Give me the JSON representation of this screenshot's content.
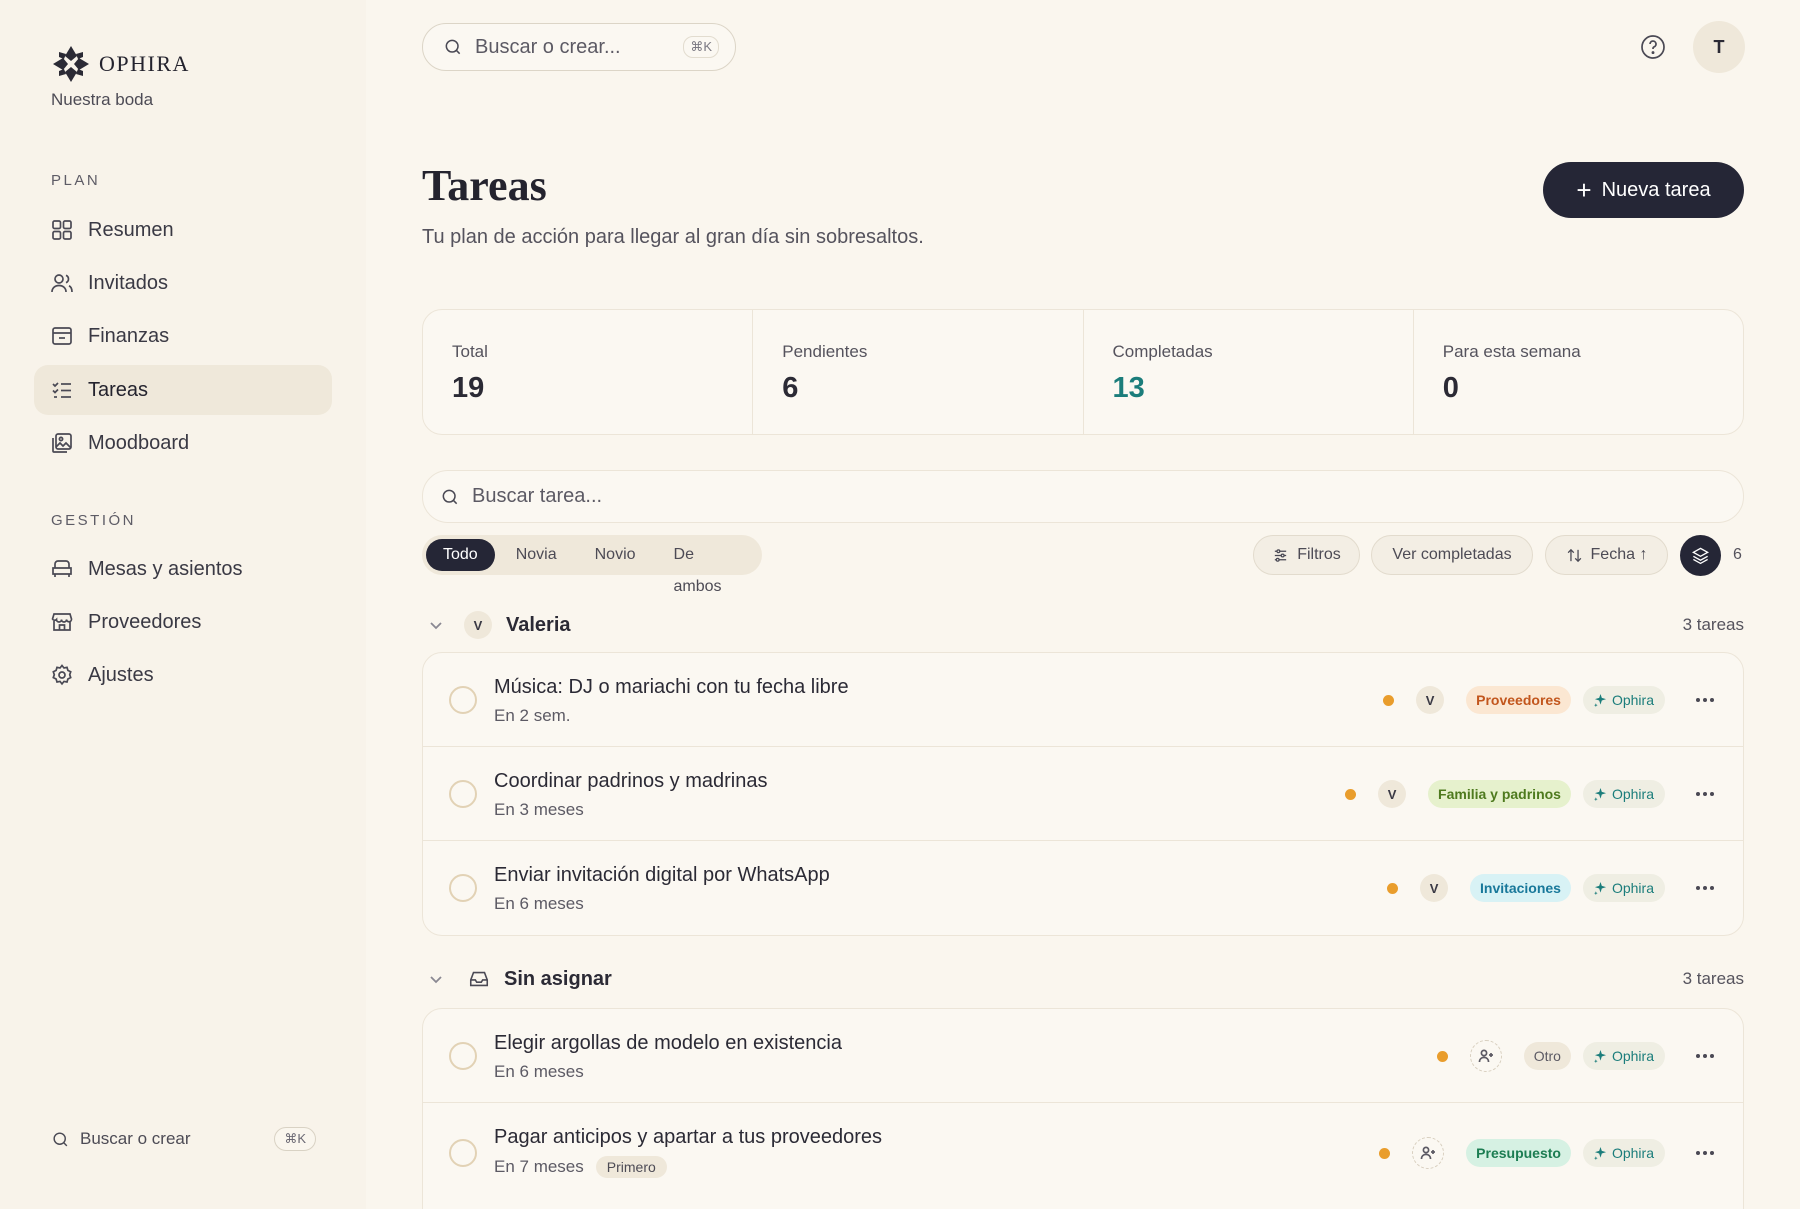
{
  "brand": {
    "name": "OPHIRA",
    "subtitle": "Nuestra boda"
  },
  "sidebar": {
    "plan_label": "PLAN",
    "plan_items": [
      {
        "label": "Resumen",
        "icon": "grid-icon"
      },
      {
        "label": "Invitados",
        "icon": "users-icon"
      },
      {
        "label": "Finanzas",
        "icon": "wallet-icon"
      },
      {
        "label": "Tareas",
        "icon": "checklist-icon",
        "active": true
      },
      {
        "label": "Moodboard",
        "icon": "image-board-icon"
      }
    ],
    "gestion_label": "GESTIÓN",
    "gestion_items": [
      {
        "label": "Mesas y asientos",
        "icon": "seat-icon"
      },
      {
        "label": "Proveedores",
        "icon": "store-icon"
      },
      {
        "label": "Ajustes",
        "icon": "gear-icon"
      }
    ],
    "search_label": "Buscar o crear",
    "search_shortcut": "⌘K"
  },
  "topbar": {
    "search_placeholder": "Buscar o crear...",
    "search_shortcut": "⌘K",
    "avatar_initial": "T"
  },
  "header": {
    "title": "Tareas",
    "subtitle": "Tu plan de acción para llegar al gran día sin sobresaltos.",
    "new_button": "Nueva tarea"
  },
  "stats": [
    {
      "label": "Total",
      "value": "19"
    },
    {
      "label": "Pendientes",
      "value": "6"
    },
    {
      "label": "Completadas",
      "value": "13"
    },
    {
      "label": "Para esta semana",
      "value": "0"
    }
  ],
  "task_search_placeholder": "Buscar tarea...",
  "filters": {
    "segments": [
      "Todo",
      "Novia",
      "Novio",
      "De ambos"
    ],
    "active_segment": "Todo",
    "filtros": "Filtros",
    "ver_completadas": "Ver completadas",
    "sort": "Fecha ↑",
    "group_count": "6"
  },
  "groups": [
    {
      "name": "Valeria",
      "badge": "V",
      "count_label": "3 tareas",
      "tasks": [
        {
          "title": "Música: DJ o mariachi con tu fecha libre",
          "due": "En 2 sem.",
          "assignee": "V",
          "category": "Proveedores",
          "category_color": "#c2561d",
          "ai_label": "Ophira"
        },
        {
          "title": "Coordinar padrinos y madrinas",
          "due": "En 3 meses",
          "assignee": "V",
          "category": "Familia y padrinos",
          "category_color": "#4e7a1e",
          "ai_label": "Ophira"
        },
        {
          "title": "Enviar invitación digital por WhatsApp",
          "due": "En 6 meses",
          "assignee": "V",
          "category": "Invitaciones",
          "category_color": "#18789a",
          "ai_label": "Ophira"
        }
      ]
    },
    {
      "name": "Sin asignar",
      "count_label": "3 tareas",
      "tasks": [
        {
          "title": "Elegir argollas de modelo en existencia",
          "due": "En 6 meses",
          "category": "Otro",
          "category_color": "#5c5a64",
          "ai_label": "Ophira"
        },
        {
          "title": "Pagar anticipos y apartar a tus proveedores",
          "due": "En 7 meses",
          "tag": "Primero",
          "category": "Presupuesto",
          "category_color": "#1c7d52",
          "ai_label": "Ophira"
        }
      ]
    }
  ],
  "colors": {
    "accent_dark": "#252636",
    "teal": "#1b7d7b",
    "priority_dot": "#e99d2c",
    "background": "#faf6ee"
  }
}
